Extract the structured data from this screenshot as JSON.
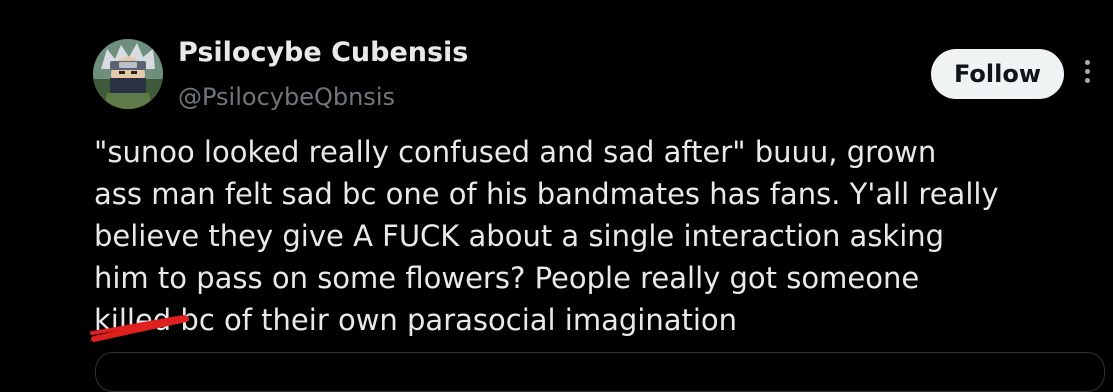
{
  "author": {
    "display_name": "Psilocybe Cubensis",
    "handle": "@PsilocybeQbnsis"
  },
  "actions": {
    "follow_label": "Follow",
    "more_icon": "more-vertical-icon"
  },
  "tweet": {
    "lines": [
      "\"sunoo looked really confused and sad after\" buuu, grown",
      "ass man felt sad bc one of his bandmates has fans. Y'all really",
      "believe they give A FUCK about a single interaction asking",
      "him to pass on some flowers? People really got someone"
    ],
    "struck_word": "killed",
    "last_line_rest": " bc of their own parasocial imagination"
  },
  "colors": {
    "background": "#000000",
    "text": "#e7e9ea",
    "secondary_text": "#71767b",
    "follow_bg": "#eff3f4",
    "scribble": "#e0201e"
  }
}
